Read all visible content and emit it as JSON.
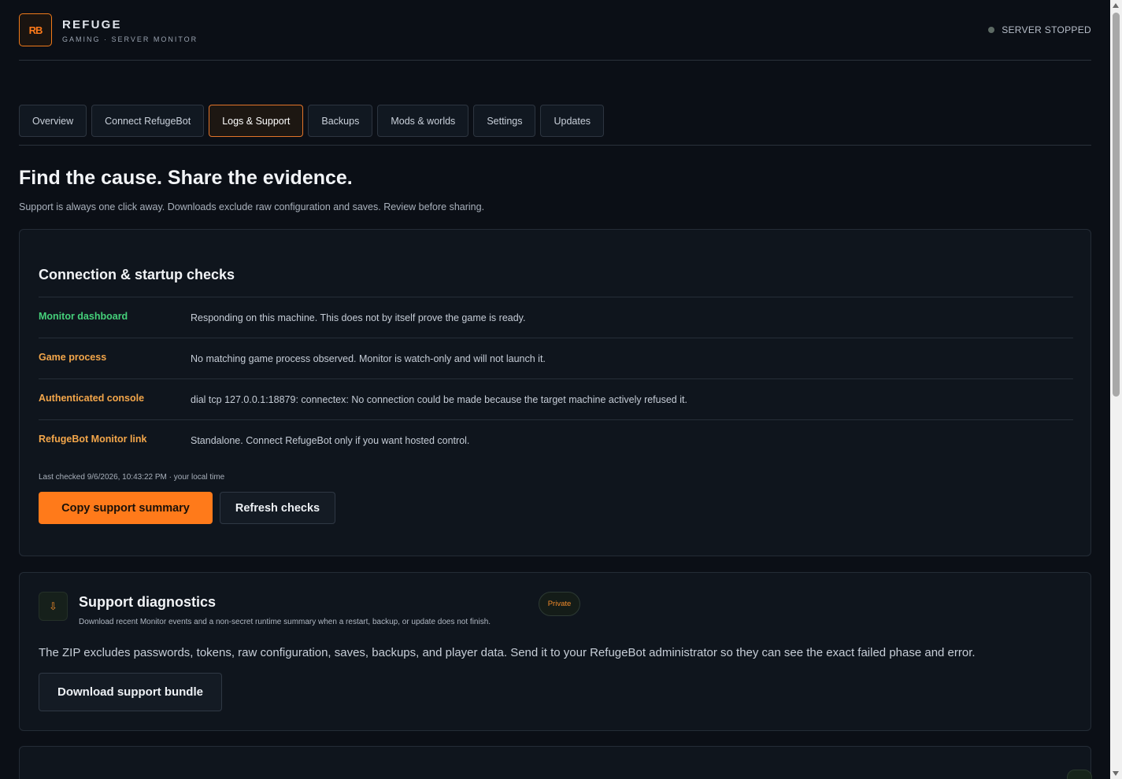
{
  "header": {
    "logo_text": "RB",
    "brand_name": "REFUGE",
    "brand_sub": "GAMING · SERVER MONITOR",
    "status_text": "SERVER STOPPED"
  },
  "tabs": [
    {
      "label": "Overview",
      "active": false
    },
    {
      "label": "Connect RefugeBot",
      "active": false
    },
    {
      "label": "Logs & Support",
      "active": true
    },
    {
      "label": "Backups",
      "active": false
    },
    {
      "label": "Mods & worlds",
      "active": false
    },
    {
      "label": "Settings",
      "active": false
    },
    {
      "label": "Updates",
      "active": false
    }
  ],
  "page": {
    "title": "Find the cause. Share the evidence.",
    "description": "Support is always one click away. Downloads exclude raw configuration and saves. Review before sharing."
  },
  "checks_card": {
    "title": "Connection & startup checks",
    "rows": [
      {
        "label": "Monitor dashboard",
        "value": "Responding on this machine. This does not by itself prove the game is ready.",
        "status": "ok"
      },
      {
        "label": "Game process",
        "value": "No matching game process observed. Monitor is watch-only and will not launch it.",
        "status": "warn"
      },
      {
        "label": "Authenticated console",
        "value": "dial tcp 127.0.0.1:18879: connectex: No connection could be made because the target machine actively refused it.",
        "status": "warn"
      },
      {
        "label": "RefugeBot Monitor link",
        "value": "Standalone. Connect RefugeBot only if you want hosted control.",
        "status": "warn"
      }
    ],
    "last_checked": "Last checked 9/6/2026, 10:43:22 PM · your local time",
    "copy_label": "Copy support summary",
    "refresh_label": "Refresh checks"
  },
  "diagnostics_card": {
    "icon_glyph": "⇩",
    "title": "Support diagnostics",
    "subtitle": "Download recent Monitor events and a non-secret runtime summary when a restart, backup, or update does not finish.",
    "badge": "Private",
    "body": "The ZIP excludes passwords, tokens, raw configuration, saves, backups, and player data. Send it to your RefugeBot administrator so they can see the exact failed phase and error.",
    "download_label": "Download support bundle"
  },
  "colors": {
    "accent": "#ff7a1a",
    "ok": "#45d07a",
    "warn": "#f3a64a",
    "background": "#0b0f16"
  }
}
